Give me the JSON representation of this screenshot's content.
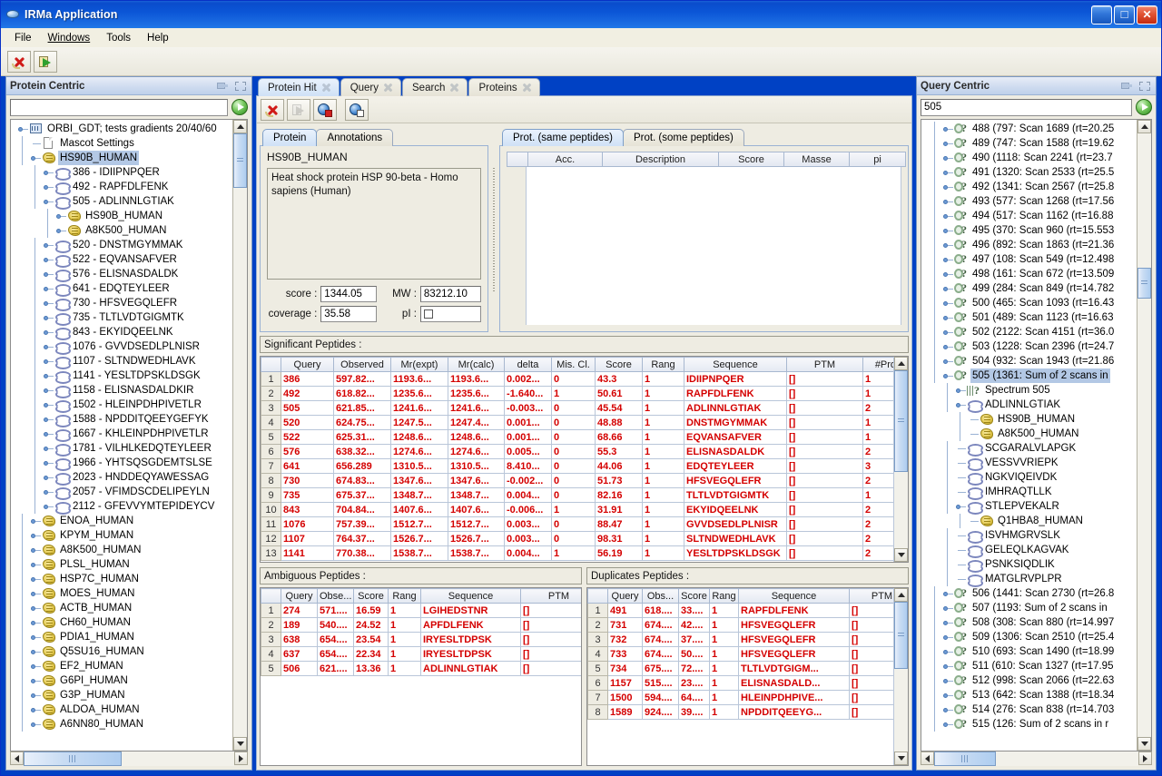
{
  "window": {
    "title": "IRMa Application",
    "icon": "app-icon",
    "buttons": {
      "minimize": "_",
      "maximize": "□",
      "close": "✕"
    }
  },
  "menu": {
    "items": [
      "File",
      "Windows",
      "Tools",
      "Help"
    ]
  },
  "toolbar": {
    "buttons": [
      "delete-icon",
      "export-icon"
    ]
  },
  "left_panel": {
    "title": "Protein Centric",
    "search": {
      "value": "",
      "placeholder": ""
    },
    "go_label": "go-icon",
    "tree": [
      {
        "label": "ORBI_GDT; tests gradients 20/40/60",
        "icon": "database-icon",
        "depth": 0,
        "handle": "expanded"
      },
      {
        "label": "Mascot Settings",
        "icon": "document-icon",
        "depth": 1,
        "handle": "none"
      },
      {
        "label": "HS90B_HUMAN",
        "icon": "protein-icon",
        "depth": 1,
        "handle": "expanded",
        "selected": true
      },
      {
        "label": "386 - IDIIPNPQER",
        "icon": "peptide-icon",
        "depth": 2,
        "handle": "collapsed"
      },
      {
        "label": "492 - RAPFDLFENK",
        "icon": "peptide-icon",
        "depth": 2,
        "handle": "collapsed"
      },
      {
        "label": "505 - ADLINNLGTIAK",
        "icon": "peptide-icon",
        "depth": 2,
        "handle": "expanded"
      },
      {
        "label": "HS90B_HUMAN",
        "icon": "protein-icon",
        "depth": 3,
        "handle": "collapsed"
      },
      {
        "label": "A8K500_HUMAN",
        "icon": "protein-icon",
        "depth": 3,
        "handle": "collapsed"
      },
      {
        "label": "520 - DNSTMGYMMAK",
        "icon": "peptide-icon",
        "depth": 2,
        "handle": "collapsed"
      },
      {
        "label": "522 - EQVANSAFVER",
        "icon": "peptide-icon",
        "depth": 2,
        "handle": "collapsed"
      },
      {
        "label": "576 - ELISNASDALDK",
        "icon": "peptide-icon",
        "depth": 2,
        "handle": "collapsed"
      },
      {
        "label": "641 - EDQTEYLEER",
        "icon": "peptide-icon",
        "depth": 2,
        "handle": "collapsed"
      },
      {
        "label": "730 - HFSVEGQLEFR",
        "icon": "peptide-icon",
        "depth": 2,
        "handle": "collapsed"
      },
      {
        "label": "735 - TLTLVDTGIGMTK",
        "icon": "peptide-icon",
        "depth": 2,
        "handle": "collapsed"
      },
      {
        "label": "843 - EKYIDQEELNK",
        "icon": "peptide-icon",
        "depth": 2,
        "handle": "collapsed"
      },
      {
        "label": "1076 - GVVDSEDLPLNISR",
        "icon": "peptide-icon",
        "depth": 2,
        "handle": "collapsed"
      },
      {
        "label": "1107 - SLTNDWEDHLAVK",
        "icon": "peptide-icon",
        "depth": 2,
        "handle": "collapsed"
      },
      {
        "label": "1141 - YESLTDPSKLDSGK",
        "icon": "peptide-icon",
        "depth": 2,
        "handle": "collapsed"
      },
      {
        "label": "1158 - ELISNASDALDKIR",
        "icon": "peptide-icon",
        "depth": 2,
        "handle": "collapsed"
      },
      {
        "label": "1502 - HLEINPDHPIVETLR",
        "icon": "peptide-icon",
        "depth": 2,
        "handle": "collapsed"
      },
      {
        "label": "1588 - NPDDITQEEYGEFYK",
        "icon": "peptide-icon",
        "depth": 2,
        "handle": "collapsed"
      },
      {
        "label": "1667 - KHLEINPDHPIVETLR",
        "icon": "peptide-icon",
        "depth": 2,
        "handle": "collapsed"
      },
      {
        "label": "1781 - VILHLKEDQTEYLEER",
        "icon": "peptide-icon",
        "depth": 2,
        "handle": "collapsed"
      },
      {
        "label": "1966 - YHTSQSGDEMTSLSE",
        "icon": "peptide-icon",
        "depth": 2,
        "handle": "collapsed"
      },
      {
        "label": "2023 - HNDDEQYAWESSAG",
        "icon": "peptide-icon",
        "depth": 2,
        "handle": "collapsed"
      },
      {
        "label": "2057 - VFIMDSCDELIPEYLN",
        "icon": "peptide-icon",
        "depth": 2,
        "handle": "collapsed"
      },
      {
        "label": "2112 - GFEVVYMTEPIDEYCV",
        "icon": "peptide-icon",
        "depth": 2,
        "handle": "collapsed"
      },
      {
        "label": "ENOA_HUMAN",
        "icon": "protein-icon",
        "depth": 1,
        "handle": "collapsed"
      },
      {
        "label": "KPYM_HUMAN",
        "icon": "protein-icon",
        "depth": 1,
        "handle": "collapsed"
      },
      {
        "label": "A8K500_HUMAN",
        "icon": "protein-icon",
        "depth": 1,
        "handle": "collapsed"
      },
      {
        "label": "PLSL_HUMAN",
        "icon": "protein-icon",
        "depth": 1,
        "handle": "collapsed"
      },
      {
        "label": "HSP7C_HUMAN",
        "icon": "protein-icon",
        "depth": 1,
        "handle": "collapsed"
      },
      {
        "label": "MOES_HUMAN",
        "icon": "protein-icon",
        "depth": 1,
        "handle": "collapsed"
      },
      {
        "label": "ACTB_HUMAN",
        "icon": "protein-icon",
        "depth": 1,
        "handle": "collapsed"
      },
      {
        "label": "CH60_HUMAN",
        "icon": "protein-icon",
        "depth": 1,
        "handle": "collapsed"
      },
      {
        "label": "PDIA1_HUMAN",
        "icon": "protein-icon",
        "depth": 1,
        "handle": "collapsed"
      },
      {
        "label": "Q5SU16_HUMAN",
        "icon": "protein-icon",
        "depth": 1,
        "handle": "collapsed"
      },
      {
        "label": "EF2_HUMAN",
        "icon": "protein-icon",
        "depth": 1,
        "handle": "collapsed"
      },
      {
        "label": "G6PI_HUMAN",
        "icon": "protein-icon",
        "depth": 1,
        "handle": "collapsed"
      },
      {
        "label": "G3P_HUMAN",
        "icon": "protein-icon",
        "depth": 1,
        "handle": "collapsed"
      },
      {
        "label": "ALDOA_HUMAN",
        "icon": "protein-icon",
        "depth": 1,
        "handle": "collapsed"
      },
      {
        "label": "A6NN80_HUMAN",
        "icon": "protein-icon",
        "depth": 1,
        "handle": "collapsed"
      }
    ]
  },
  "center": {
    "tabs": [
      {
        "label": "Protein Hit",
        "active": true
      },
      {
        "label": "Query",
        "active": false
      },
      {
        "label": "Search",
        "active": false
      },
      {
        "label": "Proteins",
        "active": false
      }
    ],
    "sub_toolbar": [
      "delete-icon",
      "forward-icon-disabled",
      "globe-red-icon",
      "globe-white-icon"
    ],
    "protein_card": {
      "tabs": [
        {
          "label": "Protein",
          "active": true
        },
        {
          "label": "Annotations",
          "active": false
        }
      ],
      "name": "HS90B_HUMAN",
      "description": "Heat shock protein HSP 90-beta - Homo sapiens (Human)",
      "fields": [
        {
          "label": "score :",
          "value": "1344.05"
        },
        {
          "label": "MW :",
          "value": "83212.10"
        },
        {
          "label": "coverage :",
          "value": "35.58"
        },
        {
          "label": "pI :",
          "value": ""
        }
      ]
    },
    "prot_card": {
      "tabs": [
        {
          "label": "Prot. (same peptides)",
          "active": true
        },
        {
          "label": "Prot. (some peptides)",
          "active": false
        }
      ],
      "columns": [
        "",
        "Acc.",
        "Description",
        "Score",
        "Masse",
        "pi"
      ],
      "rows": []
    },
    "significant": {
      "title": "Significant Peptides :",
      "columns": [
        "",
        "Query",
        "Observed",
        "Mr(expt)",
        "Mr(calc)",
        "delta",
        "Mis. Cl.",
        "Score",
        "Rang",
        "Sequence",
        "PTM",
        "#Prot."
      ],
      "rows": [
        [
          "1",
          "386",
          "597.82...",
          "1193.6...",
          "1193.6...",
          "0.002...",
          "0",
          "43.3",
          "1",
          "IDIIPNPQER",
          "[]",
          "1"
        ],
        [
          "2",
          "492",
          "618.82...",
          "1235.6...",
          "1235.6...",
          "-1.640...",
          "1",
          "50.61",
          "1",
          "RAPFDLFENK",
          "[]",
          "1"
        ],
        [
          "3",
          "505",
          "621.85...",
          "1241.6...",
          "1241.6...",
          "-0.003...",
          "0",
          "45.54",
          "1",
          "ADLINNLGTIAK",
          "[]",
          "2"
        ],
        [
          "4",
          "520",
          "624.75...",
          "1247.5...",
          "1247.4...",
          "0.001...",
          "0",
          "48.88",
          "1",
          "DNSTMGYMMAK",
          "[]",
          "1"
        ],
        [
          "5",
          "522",
          "625.31...",
          "1248.6...",
          "1248.6...",
          "0.001...",
          "0",
          "68.66",
          "1",
          "EQVANSAFVER",
          "[]",
          "1"
        ],
        [
          "6",
          "576",
          "638.32...",
          "1274.6...",
          "1274.6...",
          "0.005...",
          "0",
          "55.3",
          "1",
          "ELISNASDALDK",
          "[]",
          "2"
        ],
        [
          "7",
          "641",
          "656.289",
          "1310.5...",
          "1310.5...",
          "8.410...",
          "0",
          "44.06",
          "1",
          "EDQTEYLEER",
          "[]",
          "3"
        ],
        [
          "8",
          "730",
          "674.83...",
          "1347.6...",
          "1347.6...",
          "-0.002...",
          "0",
          "51.73",
          "1",
          "HFSVEGQLEFR",
          "[]",
          "2"
        ],
        [
          "9",
          "735",
          "675.37...",
          "1348.7...",
          "1348.7...",
          "0.004...",
          "0",
          "82.16",
          "1",
          "TLTLVDTGIGMTK",
          "[]",
          "1"
        ],
        [
          "10",
          "843",
          "704.84...",
          "1407.6...",
          "1407.6...",
          "-0.006...",
          "1",
          "31.91",
          "1",
          "EKYIDQEELNK",
          "[]",
          "2"
        ],
        [
          "11",
          "1076",
          "757.39...",
          "1512.7...",
          "1512.7...",
          "0.003...",
          "0",
          "88.47",
          "1",
          "GVVDSEDLPLNISR",
          "[]",
          "2"
        ],
        [
          "12",
          "1107",
          "764.37...",
          "1526.7...",
          "1526.7...",
          "0.003...",
          "0",
          "98.31",
          "1",
          "SLTNDWEDHLAVK",
          "[]",
          "2"
        ],
        [
          "13",
          "1141",
          "770.38...",
          "1538.7...",
          "1538.7...",
          "0.004...",
          "1",
          "56.19",
          "1",
          "YESLTDPSKLDSGK",
          "[]",
          "2"
        ]
      ]
    },
    "ambiguous": {
      "title": "Ambiguous Peptides :",
      "columns": [
        "",
        "Query",
        "Obse...",
        "Score",
        "Rang",
        "Sequence",
        "PTM"
      ],
      "rows": [
        [
          "1",
          "274",
          "571....",
          "16.59",
          "1",
          "LGIHEDSTNR",
          "[]"
        ],
        [
          "2",
          "189",
          "540....",
          "24.52",
          "1",
          "APFDLFENK",
          "[]"
        ],
        [
          "3",
          "638",
          "654....",
          "23.54",
          "1",
          "IRYESLTDPSK",
          "[]"
        ],
        [
          "4",
          "637",
          "654....",
          "22.34",
          "1",
          "IRYESLTDPSK",
          "[]"
        ],
        [
          "5",
          "506",
          "621....",
          "13.36",
          "1",
          "ADLINNLGTIAK",
          "[]"
        ]
      ]
    },
    "duplicates": {
      "title": "Duplicates Peptides :",
      "columns": [
        "",
        "Query",
        "Obs...",
        "Score",
        "Rang",
        "Sequence",
        "PTM"
      ],
      "rows": [
        [
          "1",
          "491",
          "618....",
          "33....",
          "1",
          "RAPFDLFENK",
          "[]"
        ],
        [
          "2",
          "731",
          "674....",
          "42....",
          "1",
          "HFSVEGQLEFR",
          "[]"
        ],
        [
          "3",
          "732",
          "674....",
          "37....",
          "1",
          "HFSVEGQLEFR",
          "[]"
        ],
        [
          "4",
          "733",
          "674....",
          "50....",
          "1",
          "HFSVEGQLEFR",
          "[]"
        ],
        [
          "5",
          "734",
          "675....",
          "72....",
          "1",
          "TLTLVDTGIGM...",
          "[]"
        ],
        [
          "6",
          "1157",
          "515....",
          "23....",
          "1",
          "ELISNASDALD...",
          "[]"
        ],
        [
          "7",
          "1500",
          "594....",
          "64....",
          "1",
          "HLEINPDHPIVE...",
          "[]"
        ],
        [
          "8",
          "1589",
          "924....",
          "39....",
          "1",
          "NPDDITQEEYG...",
          "[]"
        ]
      ]
    }
  },
  "right_panel": {
    "title": "Query Centric",
    "search": {
      "value": "505",
      "placeholder": ""
    },
    "go_label": "go-icon",
    "tree": [
      {
        "label": "488 (797: Scan 1689 (rt=20.25",
        "icon": "query-icon",
        "depth": 1,
        "handle": "collapsed"
      },
      {
        "label": "489 (747: Scan 1588 (rt=19.62",
        "icon": "query-icon",
        "depth": 1,
        "handle": "collapsed"
      },
      {
        "label": "490 (1118: Scan 2241 (rt=23.7",
        "icon": "query-icon",
        "depth": 1,
        "handle": "collapsed"
      },
      {
        "label": "491 (1320: Scan 2533 (rt=25.5",
        "icon": "query-icon",
        "depth": 1,
        "handle": "collapsed"
      },
      {
        "label": "492 (1341: Scan 2567 (rt=25.8",
        "icon": "query-icon",
        "depth": 1,
        "handle": "collapsed"
      },
      {
        "label": "493 (577: Scan 1268 (rt=17.56",
        "icon": "query-icon",
        "depth": 1,
        "handle": "collapsed"
      },
      {
        "label": "494 (517: Scan 1162 (rt=16.88",
        "icon": "query-icon",
        "depth": 1,
        "handle": "collapsed"
      },
      {
        "label": "495 (370: Scan 960 (rt=15.553",
        "icon": "query-icon",
        "depth": 1,
        "handle": "collapsed"
      },
      {
        "label": "496 (892: Scan 1863 (rt=21.36",
        "icon": "query-icon",
        "depth": 1,
        "handle": "collapsed"
      },
      {
        "label": "497 (108: Scan 549 (rt=12.498",
        "icon": "query-icon",
        "depth": 1,
        "handle": "collapsed"
      },
      {
        "label": "498 (161: Scan 672 (rt=13.509",
        "icon": "query-icon",
        "depth": 1,
        "handle": "collapsed"
      },
      {
        "label": "499 (284: Scan 849 (rt=14.782",
        "icon": "query-icon",
        "depth": 1,
        "handle": "collapsed"
      },
      {
        "label": "500 (465: Scan 1093 (rt=16.43",
        "icon": "query-icon",
        "depth": 1,
        "handle": "collapsed"
      },
      {
        "label": "501 (489: Scan 1123 (rt=16.63",
        "icon": "query-icon",
        "depth": 1,
        "handle": "collapsed"
      },
      {
        "label": "502 (2122: Scan 4151 (rt=36.0",
        "icon": "query-icon",
        "depth": 1,
        "handle": "collapsed"
      },
      {
        "label": "503 (1228: Scan 2396 (rt=24.7",
        "icon": "query-icon",
        "depth": 1,
        "handle": "collapsed"
      },
      {
        "label": "504 (932: Scan 1943 (rt=21.86",
        "icon": "query-icon",
        "depth": 1,
        "handle": "collapsed"
      },
      {
        "label": "505 (1361: Sum of 2 scans in",
        "icon": "query-icon",
        "depth": 1,
        "handle": "expanded",
        "selected": true
      },
      {
        "label": "Spectrum 505",
        "icon": "spectrum-icon",
        "depth": 2,
        "handle": "collapsed"
      },
      {
        "label": "ADLINNLGTIAK",
        "icon": "peptide-icon",
        "depth": 2,
        "handle": "expanded"
      },
      {
        "label": "HS90B_HUMAN",
        "icon": "protein-icon",
        "depth": 3,
        "handle": "none"
      },
      {
        "label": "A8K500_HUMAN",
        "icon": "protein-icon",
        "depth": 3,
        "handle": "none"
      },
      {
        "label": "SCGARALVLAPGK",
        "icon": "peptide-icon",
        "depth": 2,
        "handle": "none"
      },
      {
        "label": "VESSVVRIEPK",
        "icon": "peptide-icon",
        "depth": 2,
        "handle": "none"
      },
      {
        "label": "NGKVIQEIVDK",
        "icon": "peptide-icon",
        "depth": 2,
        "handle": "none"
      },
      {
        "label": "IMHRAQTLLK",
        "icon": "peptide-icon",
        "depth": 2,
        "handle": "none"
      },
      {
        "label": "STLEPVEKALR",
        "icon": "peptide-icon",
        "depth": 2,
        "handle": "expanded"
      },
      {
        "label": "Q1HBA8_HUMAN",
        "icon": "protein-icon",
        "depth": 3,
        "handle": "none"
      },
      {
        "label": "ISVHMGRVSLK",
        "icon": "peptide-icon",
        "depth": 2,
        "handle": "none"
      },
      {
        "label": "GELEQLKAGVAK",
        "icon": "peptide-icon",
        "depth": 2,
        "handle": "none"
      },
      {
        "label": "PSNKSIQDLIK",
        "icon": "peptide-icon",
        "depth": 2,
        "handle": "none"
      },
      {
        "label": "MATGLRVPLPR",
        "icon": "peptide-icon",
        "depth": 2,
        "handle": "none"
      },
      {
        "label": "506 (1441: Scan 2730 (rt=26.8",
        "icon": "query-icon",
        "depth": 1,
        "handle": "collapsed"
      },
      {
        "label": "507 (1193: Sum of 2 scans in",
        "icon": "query-icon",
        "depth": 1,
        "handle": "collapsed"
      },
      {
        "label": "508 (308: Scan 880 (rt=14.997",
        "icon": "query-icon",
        "depth": 1,
        "handle": "collapsed"
      },
      {
        "label": "509 (1306: Scan 2510 (rt=25.4",
        "icon": "query-icon",
        "depth": 1,
        "handle": "collapsed"
      },
      {
        "label": "510 (693: Scan 1490 (rt=18.99",
        "icon": "query-icon",
        "depth": 1,
        "handle": "collapsed"
      },
      {
        "label": "511 (610: Scan 1327 (rt=17.95",
        "icon": "query-icon",
        "depth": 1,
        "handle": "collapsed"
      },
      {
        "label": "512 (998: Scan 2066 (rt=22.63",
        "icon": "query-icon",
        "depth": 1,
        "handle": "collapsed"
      },
      {
        "label": "513 (642: Scan 1388 (rt=18.34",
        "icon": "query-icon",
        "depth": 1,
        "handle": "collapsed"
      },
      {
        "label": "514 (276: Scan 838 (rt=14.703",
        "icon": "query-icon",
        "depth": 1,
        "handle": "collapsed"
      },
      {
        "label": "515 (126: Sum of 2 scans in r",
        "icon": "query-icon",
        "depth": 1,
        "handle": "collapsed"
      }
    ]
  },
  "colors": {
    "title_bar": "#0a4ccc",
    "panel_bg": "#eeece2",
    "table_text": "#d40000",
    "selection": "#b3c8e5",
    "desktop": "#0041c4"
  }
}
